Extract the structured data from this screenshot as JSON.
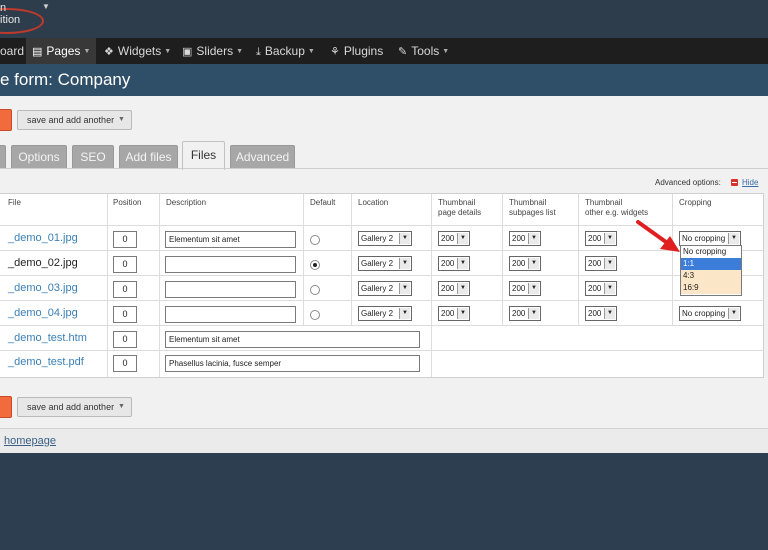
{
  "header": {
    "logo_line1": "n",
    "logo_line2": "ition"
  },
  "nav": {
    "items": [
      {
        "label": "oard"
      },
      {
        "label": "Pages"
      },
      {
        "label": "Widgets"
      },
      {
        "label": "Sliders"
      },
      {
        "label": "Backup"
      },
      {
        "label": "Plugins"
      },
      {
        "label": "Tools"
      }
    ]
  },
  "page": {
    "title": "e form: Company"
  },
  "actions": {
    "save_another_label": "save and add another"
  },
  "tabs": [
    {
      "label": "Options"
    },
    {
      "label": "SEO"
    },
    {
      "label": "Add files"
    },
    {
      "label": "Files"
    },
    {
      "label": "Advanced"
    }
  ],
  "advanced_options": {
    "label": "Advanced options:",
    "hide_label": "Hide"
  },
  "table": {
    "headers": {
      "file": "File",
      "position": "Position",
      "description": "Description",
      "default": "Default",
      "location": "Location",
      "thumb_page_1": "Thumbnail",
      "thumb_page_2": "page details",
      "thumb_sub_1": "Thumbnail",
      "thumb_sub_2": "subpages list",
      "thumb_other_1": "Thumbnail",
      "thumb_other_2": "other e.g. widgets",
      "cropping": "Cropping"
    },
    "rows": [
      {
        "file": "_demo_01.jpg",
        "position": "0",
        "description": "Elementum sit amet",
        "location": "Gallery 2",
        "thumb_page": "200",
        "thumb_sub": "200",
        "thumb_other": "200",
        "cropping": "No cropping"
      },
      {
        "file": "_demo_02.jpg",
        "position": "0",
        "description": "",
        "location": "Gallery 2",
        "thumb_page": "200",
        "thumb_sub": "200",
        "thumb_other": "200"
      },
      {
        "file": "_demo_03.jpg",
        "position": "0",
        "description": "",
        "location": "Gallery 2",
        "thumb_page": "200",
        "thumb_sub": "200",
        "thumb_other": "200"
      },
      {
        "file": "_demo_04.jpg",
        "position": "0",
        "description": "",
        "location": "Gallery 2",
        "thumb_page": "200",
        "thumb_sub": "200",
        "thumb_other": "200",
        "cropping": "No cropping"
      },
      {
        "file": "_demo_test.htm",
        "position": "0",
        "description": "Elementum sit amet"
      },
      {
        "file": "_demo_test.pdf",
        "position": "0",
        "description": "Phasellus lacinia, fusce semper"
      }
    ]
  },
  "cropping_dropdown": {
    "options": [
      "No cropping",
      "1:1",
      "4:3",
      "16:9"
    ],
    "highlighted": "1:1"
  },
  "footer": {
    "homepage_link": "homepage"
  },
  "colors": {
    "accent_orange": "#f26b3f",
    "arrow_red": "#e02020",
    "link_blue": "#3b7fb5",
    "topbar": "#2e3d4c"
  }
}
